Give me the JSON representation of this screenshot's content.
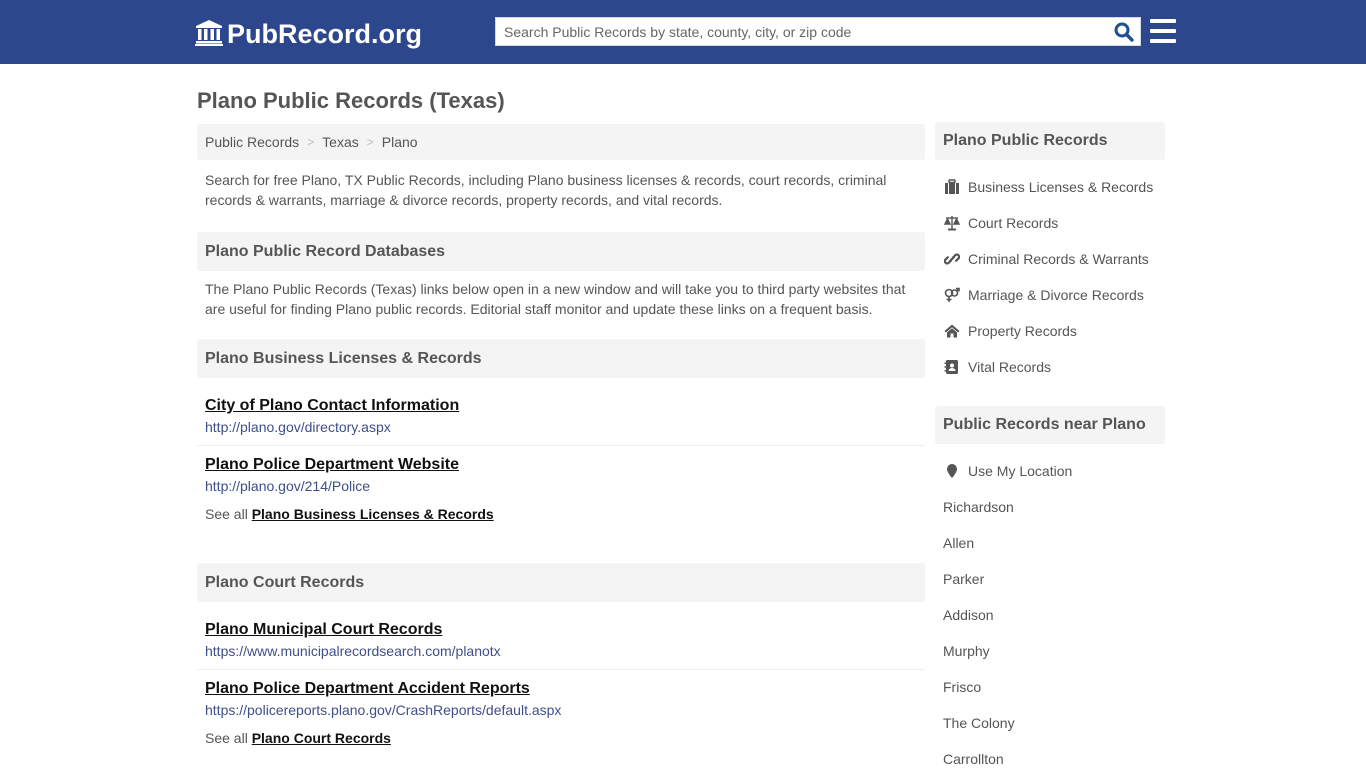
{
  "header": {
    "logo_text": "PubRecord.org",
    "logo_icon": "courthouse-icon",
    "search_placeholder": "Search Public Records by state, county, city, or zip code",
    "search_value": "",
    "search_icon": "search-icon",
    "menu_icon": "hamburger-menu-icon"
  },
  "colors": {
    "brand_bar": "#2d478d",
    "url_text": "#3e4f89",
    "search_icon": "#1f4f94",
    "section_bg": "#f4f4f4"
  },
  "page": {
    "title": "Plano Public Records (Texas)"
  },
  "breadcrumb": [
    {
      "label": "Public Records"
    },
    {
      "label": "Texas"
    },
    {
      "label": "Plano"
    }
  ],
  "intro": "Search for free Plano, TX Public Records, including Plano business licenses & records, court records, criminal records & warrants, marriage & divorce records, property records, and vital records.",
  "databases": {
    "heading": "Plano Public Record Databases",
    "text": "The Plano Public Records (Texas) links below open in a new window and will take you to third party websites that are useful for finding Plano public records. Editorial staff monitor and update these links on a frequent basis."
  },
  "sections": [
    {
      "heading": "Plano Business Licenses & Records",
      "links": [
        {
          "title": "City of Plano Contact Information",
          "url": "http://plano.gov/directory.aspx"
        },
        {
          "title": "Plano Police Department Website",
          "url": "http://plano.gov/214/Police"
        }
      ],
      "see_all_prefix": "See all",
      "see_all_label": "Plano Business Licenses & Records"
    },
    {
      "heading": "Plano Court Records",
      "links": [
        {
          "title": "Plano Municipal Court Records",
          "url": "https://www.municipalrecordsearch.com/planotx"
        },
        {
          "title": "Plano Police Department Accident Reports",
          "url": "https://policereports.plano.gov/CrashReports/default.aspx"
        }
      ],
      "see_all_prefix": "See all",
      "see_all_label": "Plano Court Records"
    }
  ],
  "sidebar": {
    "records_heading": "Plano Public Records",
    "records_items": [
      {
        "label": "Business Licenses & Records",
        "icon": "briefcase-icon"
      },
      {
        "label": "Court Records",
        "icon": "balance-scale-icon"
      },
      {
        "label": "Criminal Records & Warrants",
        "icon": "link-icon"
      },
      {
        "label": "Marriage & Divorce Records",
        "icon": "venus-mars-icon"
      },
      {
        "label": "Property Records",
        "icon": "home-icon"
      },
      {
        "label": "Vital Records",
        "icon": "address-book-icon"
      }
    ],
    "nearby_heading": "Public Records near Plano",
    "use_location_label": "Use My Location",
    "use_location_icon": "map-marker-icon",
    "nearby_cities": [
      "Richardson",
      "Allen",
      "Parker",
      "Addison",
      "Murphy",
      "Frisco",
      "The Colony",
      "Carrollton"
    ]
  }
}
